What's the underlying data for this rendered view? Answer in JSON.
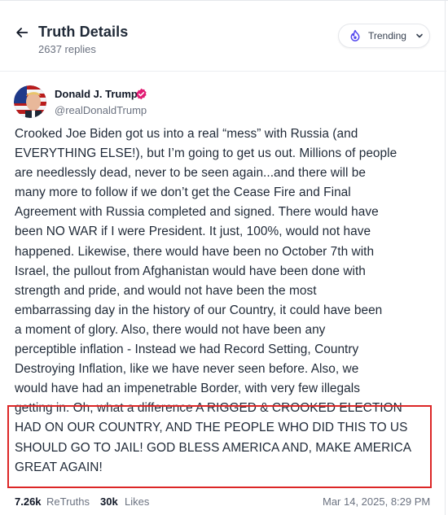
{
  "header": {
    "title": "Truth Details",
    "replies": "2637 replies",
    "trending_label": "Trending"
  },
  "post": {
    "author_name": "Donald J. Trump",
    "handle": "@realDonaldTrump",
    "lines": [
      "Crooked Joe Biden got us into a real “mess” with Russia (and",
      "EVERYTHING ELSE!), but I’m going to get us out. Millions of people",
      "are needlessly dead, never to be seen again...and there will be",
      "many more to follow if we don’t get the Cease Fire and Final",
      "Agreement with Russia completed and signed. There would have",
      "been NO WAR if I were President. It just, 100%, would not have",
      "happened. Likewise, there would have been no October 7th with",
      "Israel, the pullout from Afghanistan would have been done with",
      "strength and pride, and would not have been the most",
      "embarrassing day in the history of our Country, it could have been",
      "a moment of glory. Also, there would not have been any",
      "perceptible inflation - Instead we had Record Setting, Country",
      "Destroying Inflation, like we have never seen before. Also, we",
      "would have had an impenetrable Border, with very few illegals",
      "getting in. Oh, what a difference A RIGGED & CROOKED ELECTION",
      "HAD ON OUR COUNTRY, AND THE PEOPLE WHO DID THIS TO US",
      "SHOULD GO TO JAIL! GOD BLESS AMERICA AND, MAKE AMERICA",
      "GREAT AGAIN!"
    ],
    "retruths_count": "7.26k",
    "retruths_label": "ReTruths",
    "likes_count": "30k",
    "likes_label": "Likes",
    "timestamp": "Mar 14, 2025, 8:29 PM"
  },
  "icons": {
    "back": "arrow-left-icon",
    "trending": "flame-icon",
    "chevron": "chevron-down-icon",
    "verified": "verified-badge-icon"
  },
  "colors": {
    "brand_accent": "#5448ee",
    "verified": "#e11d74",
    "highlight_border": "#dc2626",
    "muted_text": "#6b7280"
  }
}
